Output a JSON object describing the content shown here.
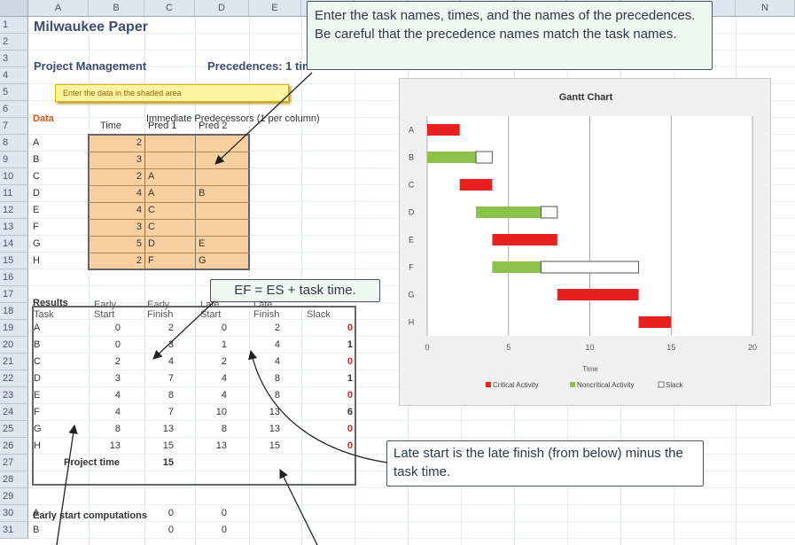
{
  "columns": [
    "A",
    "B",
    "C",
    "D",
    "E",
    "F",
    "G",
    "H",
    "I",
    "J",
    "K",
    "L",
    "M",
    "N"
  ],
  "rows": [
    "1",
    "2",
    "3",
    "4",
    "5",
    "6",
    "7",
    "8",
    "9",
    "10",
    "11",
    "12",
    "13",
    "14",
    "15",
    "16",
    "17",
    "18",
    "19",
    "20",
    "21",
    "22",
    "23",
    "24",
    "25",
    "26",
    "27",
    "28",
    "29",
    "30",
    "31"
  ],
  "sheet": {
    "title": "Milwaukee Paper",
    "subtitle": "Project Management",
    "precedences_label": "Precedences: 1 tim",
    "note": "Enter the data in the shaded area",
    "data_label": "Data",
    "predecessors_label": "Immediate Predecessors (1 per column)",
    "input_headers": [
      "Time",
      "Pred 1",
      "Pred 2"
    ],
    "input_rows": [
      {
        "task": "A",
        "time": "2",
        "pred1": "",
        "pred2": ""
      },
      {
        "task": "B",
        "time": "3",
        "pred1": "",
        "pred2": ""
      },
      {
        "task": "C",
        "time": "2",
        "pred1": "A",
        "pred2": ""
      },
      {
        "task": "D",
        "time": "4",
        "pred1": "A",
        "pred2": "B"
      },
      {
        "task": "E",
        "time": "4",
        "pred1": "C",
        "pred2": ""
      },
      {
        "task": "F",
        "time": "3",
        "pred1": "C",
        "pred2": ""
      },
      {
        "task": "G",
        "time": "5",
        "pred1": "D",
        "pred2": "E"
      },
      {
        "task": "H",
        "time": "2",
        "pred1": "F",
        "pred2": "G"
      }
    ],
    "results_label": "Results",
    "results_headers_top": [
      "Early",
      "Early",
      "Late",
      "Late"
    ],
    "results_headers": [
      "Task",
      "Start",
      "Finish",
      "Start",
      "Finish",
      "Slack"
    ],
    "results_rows": [
      {
        "task": "A",
        "es": "0",
        "ef": "2",
        "ls": "0",
        "lf": "2",
        "slack": "0"
      },
      {
        "task": "B",
        "es": "0",
        "ef": "3",
        "ls": "1",
        "lf": "4",
        "slack": "1"
      },
      {
        "task": "C",
        "es": "2",
        "ef": "4",
        "ls": "2",
        "lf": "4",
        "slack": "0"
      },
      {
        "task": "D",
        "es": "3",
        "ef": "7",
        "ls": "4",
        "lf": "8",
        "slack": "1"
      },
      {
        "task": "E",
        "es": "4",
        "ef": "8",
        "ls": "4",
        "lf": "8",
        "slack": "0"
      },
      {
        "task": "F",
        "es": "4",
        "ef": "7",
        "ls": "10",
        "lf": "13",
        "slack": "6"
      },
      {
        "task": "G",
        "es": "8",
        "ef": "13",
        "ls": "8",
        "lf": "13",
        "slack": "0"
      },
      {
        "task": "H",
        "es": "13",
        "ef": "15",
        "ls": "13",
        "lf": "15",
        "slack": "0"
      }
    ],
    "project_time_label": "Project time",
    "project_time": "15",
    "early_start_label": "Early start computations",
    "early_rows": [
      {
        "task": "A",
        "v1": "0",
        "v2": "0"
      },
      {
        "task": "B",
        "v1": "0",
        "v2": "0"
      }
    ]
  },
  "callouts": {
    "top": "Enter the task names, times, and the names of the precedences. Be careful that the precedence names match the task names.",
    "ef": "EF = ES + task time.",
    "late_start": "Late start is the late finish (from below) minus the task time."
  },
  "colors": {
    "critical": "#e8201f",
    "noncritical": "#8cc14a",
    "slack_fill": "#ffffff",
    "shade": "#f8cf9f",
    "slack_zero": "#e8201f"
  },
  "chart_data": {
    "type": "bar",
    "title": "Gantt Chart",
    "xlabel": "Time",
    "ylabel": "",
    "xlim": [
      0,
      20
    ],
    "xticks": [
      "0",
      "5",
      "10",
      "15",
      "20"
    ],
    "categories": [
      "A",
      "B",
      "C",
      "D",
      "E",
      "F",
      "G",
      "H"
    ],
    "orientation": "horizontal-stacked",
    "series": [
      {
        "name": "Critical Activity",
        "starts": [
          0,
          null,
          2,
          null,
          4,
          null,
          8,
          13
        ],
        "durations": [
          2,
          null,
          2,
          null,
          4,
          null,
          5,
          2
        ]
      },
      {
        "name": "Noncritical Activity",
        "starts": [
          null,
          0,
          null,
          3,
          null,
          4,
          null,
          null
        ],
        "durations": [
          null,
          3,
          null,
          4,
          null,
          3,
          null,
          null
        ]
      },
      {
        "name": "Slack",
        "starts": [
          null,
          3,
          null,
          7,
          null,
          7,
          null,
          null
        ],
        "durations": [
          null,
          1,
          null,
          1,
          null,
          6,
          null,
          null
        ]
      }
    ],
    "grid": true,
    "legend": "bottom"
  }
}
